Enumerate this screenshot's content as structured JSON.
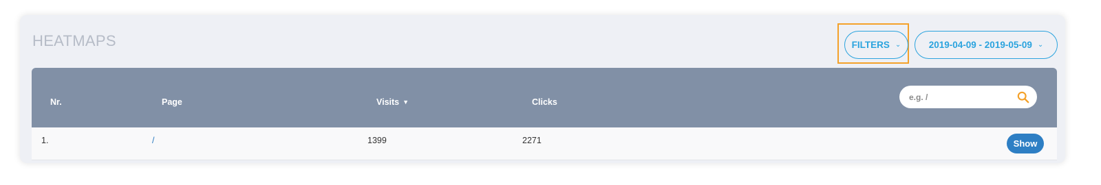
{
  "header": {
    "title": "HEATMAPS",
    "filters_label": "FILTERS",
    "date_range_label": "2019-04-09 - 2019-05-09"
  },
  "table": {
    "columns": [
      "Nr.",
      "Page",
      "Visits",
      "Clicks"
    ],
    "sorted_column": "Visits",
    "sort_direction": "descending",
    "search": {
      "placeholder": "e.g. /"
    },
    "rows": [
      {
        "nr": "1.",
        "page": "/",
        "visits": "1399",
        "clicks": "2271",
        "action_label": "Show"
      }
    ]
  },
  "colors": {
    "accent": "#2aa3de",
    "highlight": "#f4a129",
    "table_header": "#8190a6",
    "show_button": "#2e7fc4"
  }
}
